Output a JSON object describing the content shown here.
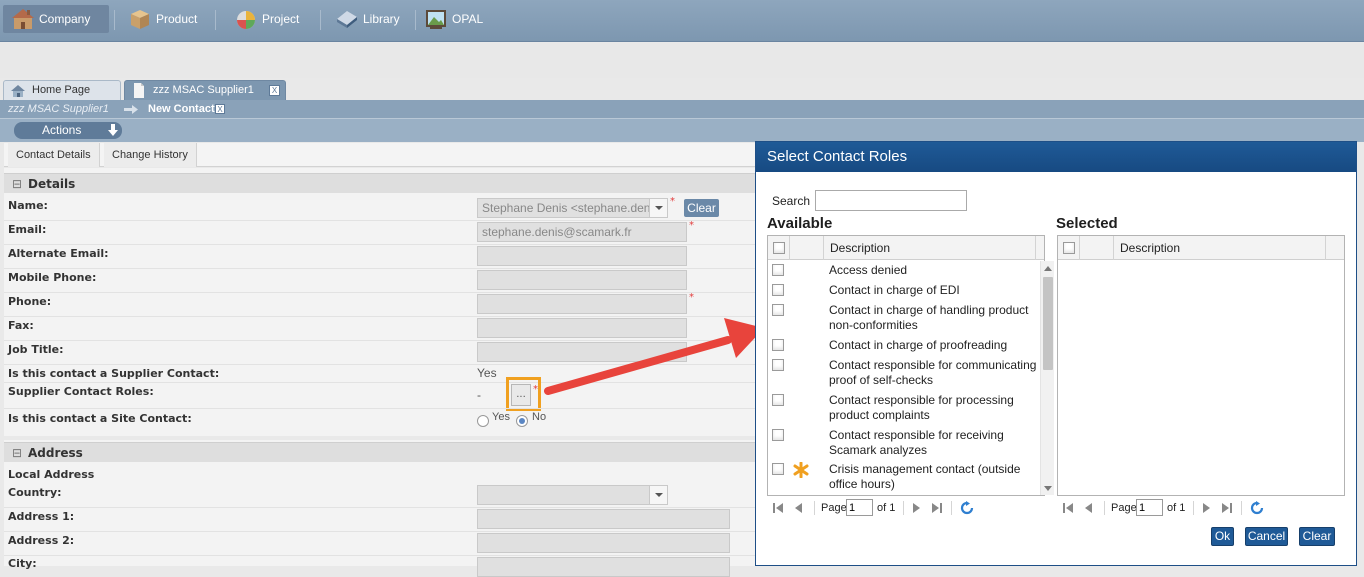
{
  "nav": {
    "items": [
      {
        "label": "Company",
        "icon": "house-icon",
        "active": true
      },
      {
        "label": "Product",
        "icon": "box-icon"
      },
      {
        "label": "Project",
        "icon": "pie-chart-icon"
      },
      {
        "label": "Library",
        "icon": "book-icon"
      },
      {
        "label": "OPAL",
        "icon": "picture-icon"
      }
    ]
  },
  "tabs": [
    {
      "label": "Home Page",
      "icon": "home-page-icon"
    },
    {
      "label": "zzz MSAC Supplier1",
      "icon": "document-icon",
      "close": "X"
    }
  ],
  "breadcrumb": {
    "previous": "zzz MSAC Supplier1",
    "current": "New Contact",
    "close": "X"
  },
  "actions": {
    "label": "Actions",
    "icon": "download-arrow-icon"
  },
  "subtabs": [
    "Contact Details",
    "Change History"
  ],
  "details": {
    "header": "Details",
    "toggle": "⊟",
    "labels": {
      "name": "Name:",
      "email": "Email:",
      "alt_email": "Alternate Email:",
      "mobile": "Mobile Phone:",
      "phone": "Phone:",
      "fax": "Fax:",
      "job_title": "Job Title:",
      "supplier_contact": "Is this contact a Supplier Contact:",
      "roles": "Supplier Contact Roles:",
      "site_contact": "Is this contact a Site Contact:"
    },
    "values": {
      "name": "Stephane Denis <stephane.den",
      "email": "stephane.denis@scamark.fr",
      "supplier_contact": "Yes",
      "roles": "-",
      "roles_button": "...",
      "site_yes": "Yes",
      "site_no": "No"
    },
    "clear_label": "Clear",
    "required_mark": "*"
  },
  "address": {
    "header": "Address",
    "toggle": "⊟",
    "local_address": "Local Address",
    "labels": {
      "country": "Country:",
      "address1": "Address 1:",
      "address2": "Address 2:",
      "city": "City:"
    }
  },
  "dialog": {
    "title": "Select Contact Roles",
    "search_label": "Search",
    "search_value": "",
    "available_heading": "Available",
    "selected_heading": "Selected",
    "column_header": "Description",
    "roles": [
      {
        "text": "Access denied"
      },
      {
        "text": "Contact in charge of EDI"
      },
      {
        "text": "Contact in charge of handling product non-conformities"
      },
      {
        "text": "Contact in charge of proofreading"
      },
      {
        "text": "Contact responsible for communicating proof of self-checks"
      },
      {
        "text": "Contact responsible for processing product complaints"
      },
      {
        "text": "Contact responsible for receiving Scamark analyzes"
      },
      {
        "text": "Crisis management contact (outside office hours)",
        "icon": "asterisk-icon"
      }
    ],
    "pager_left": {
      "page_label": "Page",
      "page": "1",
      "of": "of 1"
    },
    "pager_right": {
      "page_label": "Page",
      "page": "1",
      "of": "of 1"
    },
    "buttons": {
      "ok": "Ok",
      "cancel": "Cancel",
      "clear": "Clear"
    }
  },
  "colors": {
    "accent": "#1f5a97",
    "nav": "#7d97b0",
    "highlight": "#f0a020",
    "arrow": "#e8443c"
  }
}
